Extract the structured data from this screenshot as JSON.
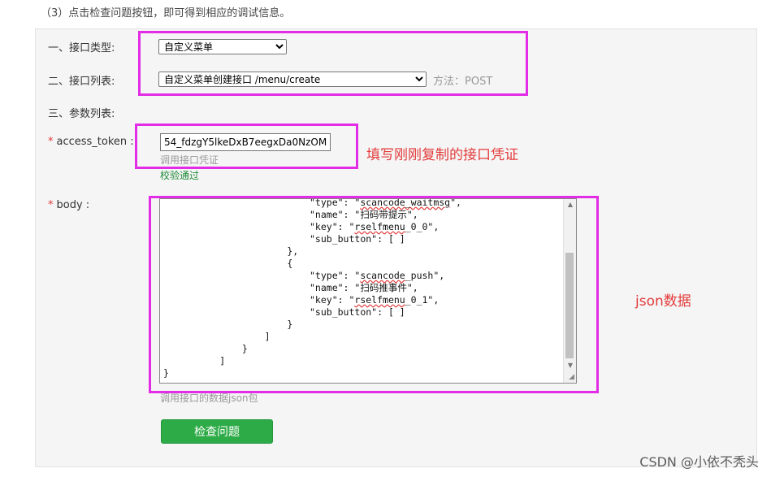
{
  "intro_text": "（3）点击检查问题按钮，即可得到相应的调试信息。",
  "form": {
    "interface_type_label": "一、接口类型:",
    "interface_type_value": "自定义菜单",
    "interface_list_label": "二、接口列表:",
    "interface_list_value": "自定义菜单创建接口 /menu/create",
    "method_text": "方法：POST",
    "params_label": "三、参数列表:",
    "required_mark": "*",
    "access_token_label": "access_token :",
    "access_token_value": "54_fdzgY5lkeDxB7eegxDa0NzOM",
    "access_token_hint": "调用接口凭证",
    "access_token_status": "校验通过",
    "body_label": "body :",
    "body_hint": "调用接口的数据json包",
    "submit_label": "检查问题"
  },
  "annotations": {
    "token_note": "填写刚刚复制的接口凭证",
    "json_note": "json数据"
  },
  "colors": {
    "highlight": "#e22ce6",
    "annotation": "#e33b3b",
    "button": "#2dab47",
    "pass_text": "#1e8a38"
  },
  "watermark": "CSDN @小依不秃头"
}
